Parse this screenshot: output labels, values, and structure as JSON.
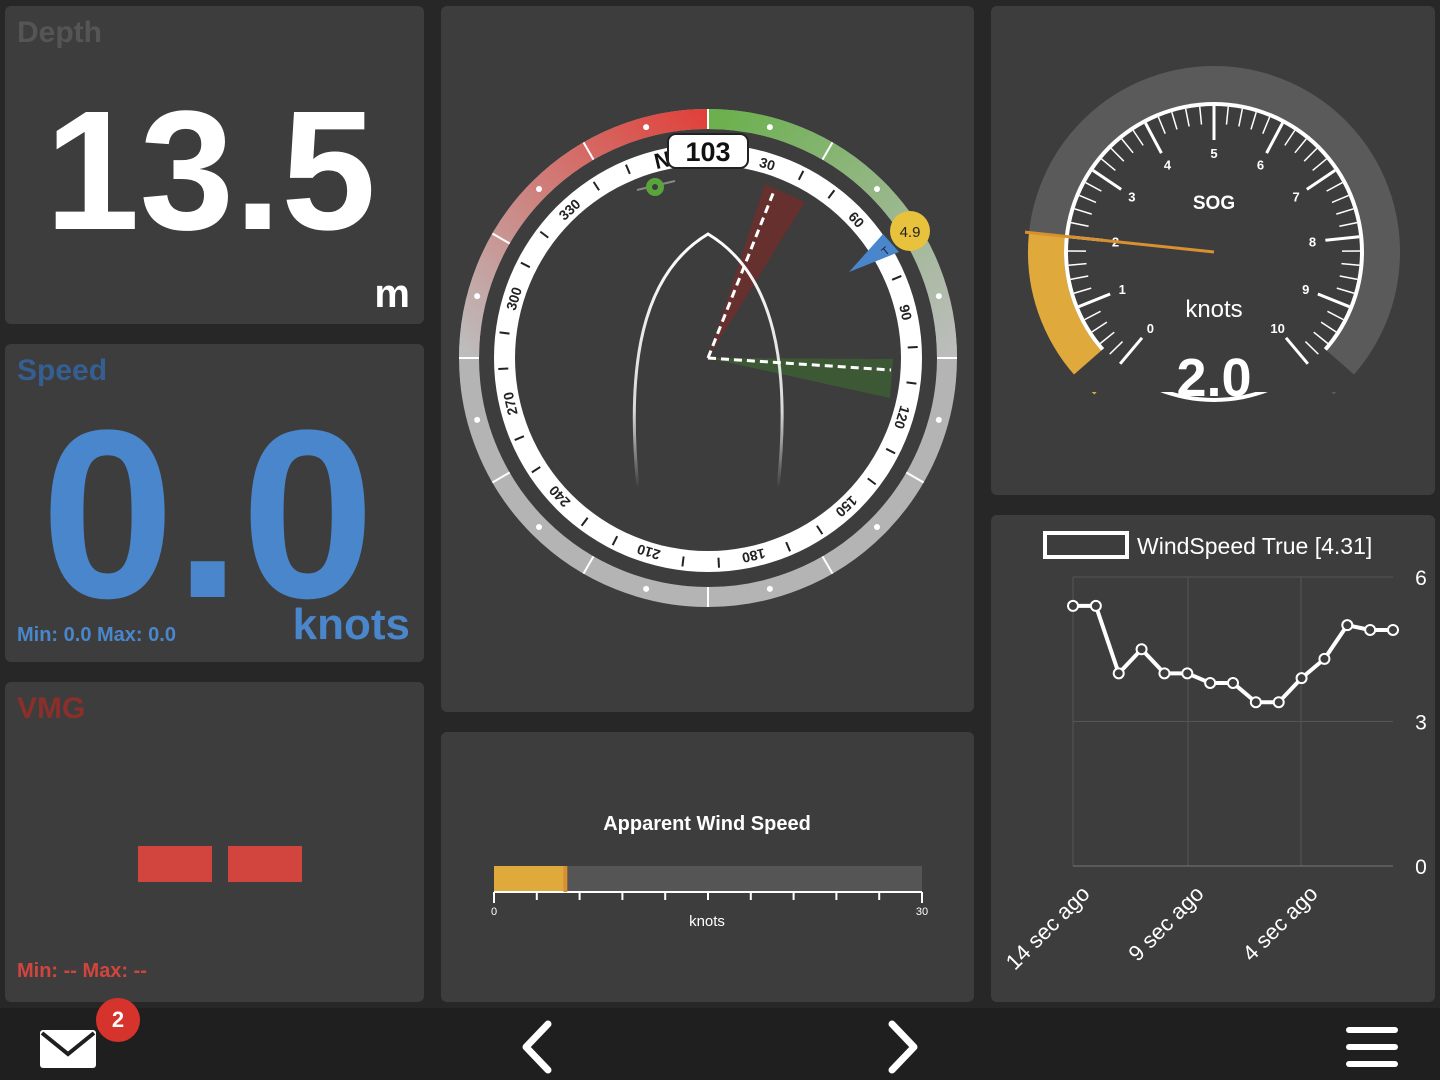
{
  "depth": {
    "title": "Depth",
    "value": "13.5",
    "unit": "m",
    "title_color": "#555555"
  },
  "speed": {
    "title": "Speed",
    "value": "0.0",
    "unit": "knots",
    "minmax": "Min: 0.0 Max: 0.0",
    "color": "#4a86cb"
  },
  "vmg": {
    "title": "VMG",
    "minmax": "Min: -- Max: --",
    "color": "#d2453e"
  },
  "compass": {
    "heading": "103",
    "wind_speed_badge": "4.9",
    "wind_badge_letter": "T",
    "north_label": "N",
    "tick_labels": [
      "30",
      "60",
      "90",
      "120",
      "150",
      "180",
      "210",
      "240",
      "270",
      "300",
      "330"
    ],
    "port_color": "#e0413a",
    "starboard_color": "#6ab04c"
  },
  "sog": {
    "label": "SOG",
    "unit": "knots",
    "value": "2.0",
    "min": 0,
    "max": 10,
    "reading": 2.0,
    "ticks": [
      "0",
      "1",
      "2",
      "3",
      "4",
      "5",
      "6",
      "7",
      "8",
      "9",
      "10"
    ],
    "highlight_color": "#e0a93b"
  },
  "aws": {
    "title": "Apparent Wind Speed",
    "unit": "knots",
    "min_label": "0",
    "max_label": "30",
    "min": 0,
    "max": 30,
    "reading": 5,
    "bar_color": "#e0a93b"
  },
  "chart_data": {
    "type": "line",
    "legend": "WindSpeed True [4.31]",
    "x_labels": [
      "14 sec ago",
      "9 sec ago",
      "4 sec ago"
    ],
    "y_ticks": [
      "6",
      "3",
      "0"
    ],
    "ylim": [
      0,
      6
    ],
    "values": [
      5.4,
      5.4,
      4.0,
      4.5,
      4.0,
      4.0,
      3.8,
      3.8,
      3.4,
      3.4,
      3.9,
      4.3,
      5.0,
      4.9,
      4.9
    ],
    "grid": true
  },
  "footer": {
    "notification_count": "2"
  }
}
